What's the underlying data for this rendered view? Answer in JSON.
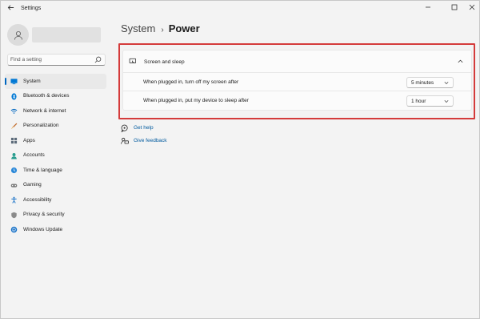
{
  "window": {
    "title": "Settings",
    "back_icon": "arrow-left-icon",
    "controls": [
      "minimize-icon",
      "maximize-icon",
      "close-icon"
    ]
  },
  "sidebar": {
    "search": {
      "placeholder": "Find a setting",
      "value": ""
    },
    "items": [
      {
        "label": "System",
        "icon": "monitor-icon",
        "active": true
      },
      {
        "label": "Bluetooth & devices",
        "icon": "bluetooth-icon",
        "active": false
      },
      {
        "label": "Network & internet",
        "icon": "wifi-icon",
        "active": false
      },
      {
        "label": "Personalization",
        "icon": "brush-icon",
        "active": false
      },
      {
        "label": "Apps",
        "icon": "apps-icon",
        "active": false
      },
      {
        "label": "Accounts",
        "icon": "person-icon",
        "active": false
      },
      {
        "label": "Time & language",
        "icon": "globe-clock-icon",
        "active": false
      },
      {
        "label": "Gaming",
        "icon": "gamepad-icon",
        "active": false
      },
      {
        "label": "Accessibility",
        "icon": "accessibility-icon",
        "active": false
      },
      {
        "label": "Privacy & security",
        "icon": "shield-icon",
        "active": false
      },
      {
        "label": "Windows Update",
        "icon": "update-icon",
        "active": false
      }
    ]
  },
  "main": {
    "breadcrumb": {
      "parent": "System",
      "separator": "›",
      "current": "Power"
    },
    "panel": {
      "title": "Screen and sleep",
      "rows": [
        {
          "label": "When plugged in, turn off my screen after",
          "value": "5 minutes"
        },
        {
          "label": "When plugged in, put my device to sleep after",
          "value": "1 hour"
        }
      ]
    },
    "links": {
      "help": "Get help",
      "feedback": "Give feedback"
    }
  },
  "colors": {
    "accent": "#0067c0",
    "link": "#005a9e",
    "highlight_border": "#d43b3b"
  }
}
